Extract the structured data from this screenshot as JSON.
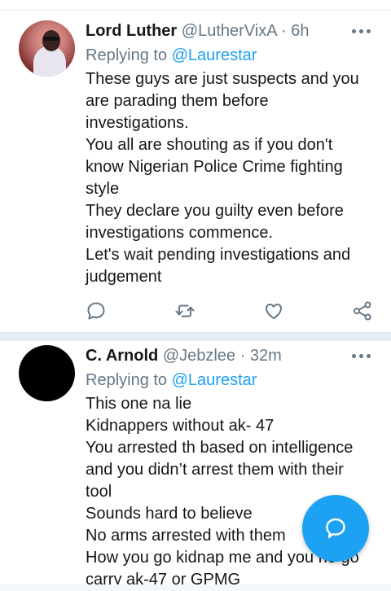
{
  "tweets": [
    {
      "display_name": "Lord Luther",
      "handle": "@LutherVixA",
      "separator": "·",
      "time": "6h",
      "replying_prefix": "Replying to",
      "replying_to": "@Laurestar",
      "lines": [
        "These guys are just suspects and you",
        "are parading them before",
        "investigations.",
        "You all are shouting as if you don't",
        "know Nigerian Police Crime fighting",
        "style",
        "They declare you guilty even before",
        "investigations commence.",
        "Let's wait pending investigations and",
        "judgement"
      ]
    },
    {
      "display_name": "C. Arnold",
      "handle": "@Jebzlee",
      "separator": "·",
      "time": "32m",
      "replying_prefix": "Replying to",
      "replying_to": "@Laurestar",
      "lines": [
        "This one na lie",
        "Kidnappers without ak- 47",
        "You arrested th based on intelligence",
        "and you didn’t arrest them with their",
        "tool",
        "Sounds hard to believe",
        "No arms arrested with them",
        "How you go kidnap me and you no go",
        "carry ak-47 or GPMG"
      ]
    }
  ],
  "icons": {
    "reply": "reply-icon",
    "retweet": "retweet-icon",
    "like": "like-icon",
    "share": "share-icon",
    "more": "more-icon",
    "compose": "compose-reply-icon"
  },
  "colors": {
    "accent": "#1da1f2",
    "text": "#14171a",
    "secondary": "#657786",
    "divider": "#e6ecf0"
  }
}
